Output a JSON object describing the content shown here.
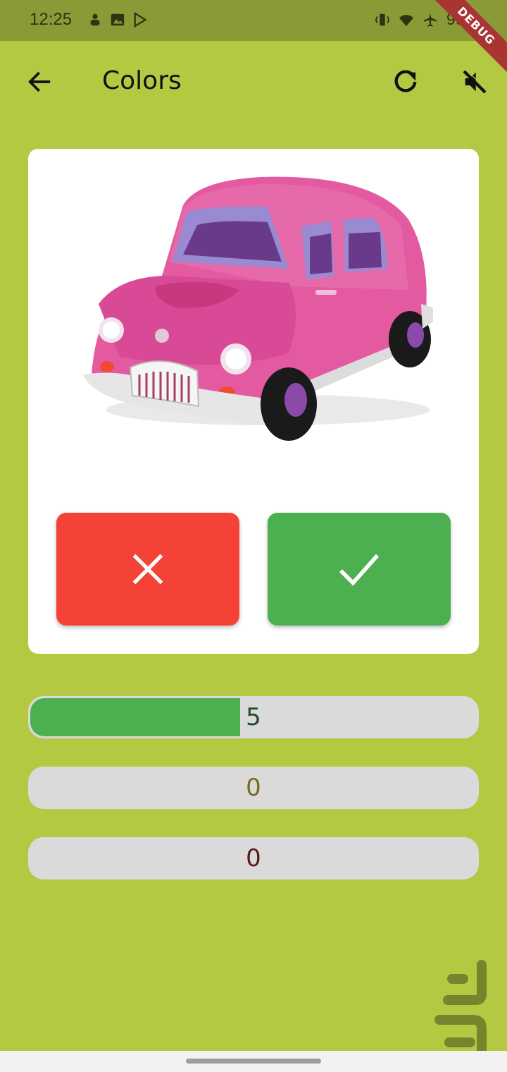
{
  "status_bar": {
    "time": "12:25",
    "battery": "99%",
    "left_icons": [
      "notification-icon",
      "image-icon",
      "play-store-icon"
    ],
    "right_icons": [
      "vibrate-icon",
      "wifi-icon",
      "airplane-icon",
      "battery-icon"
    ]
  },
  "debug_banner": "DEBUG",
  "app_bar": {
    "title": "Colors",
    "back_icon": "arrow-back-icon",
    "reload_icon": "refresh-icon",
    "mute_icon": "volume-off-icon"
  },
  "card": {
    "image": "pink-car",
    "wrong_button_icon": "close-icon",
    "right_button_icon": "check-icon",
    "wrong_color": "#f44336",
    "right_color": "#4caf50"
  },
  "scores": [
    {
      "label": "5",
      "fill_fraction": 0.47,
      "color": "#1f4d23"
    },
    {
      "label": "0",
      "fill_fraction": 0,
      "color": "#7a6a1a"
    },
    {
      "label": "0",
      "fill_fraction": 0,
      "color": "#5a1a1a"
    }
  ],
  "colors": {
    "background": "#b5c842",
    "status_bar": "#8a9a36",
    "progress_track": "#dadada",
    "progress_fill": "#4caf50"
  }
}
